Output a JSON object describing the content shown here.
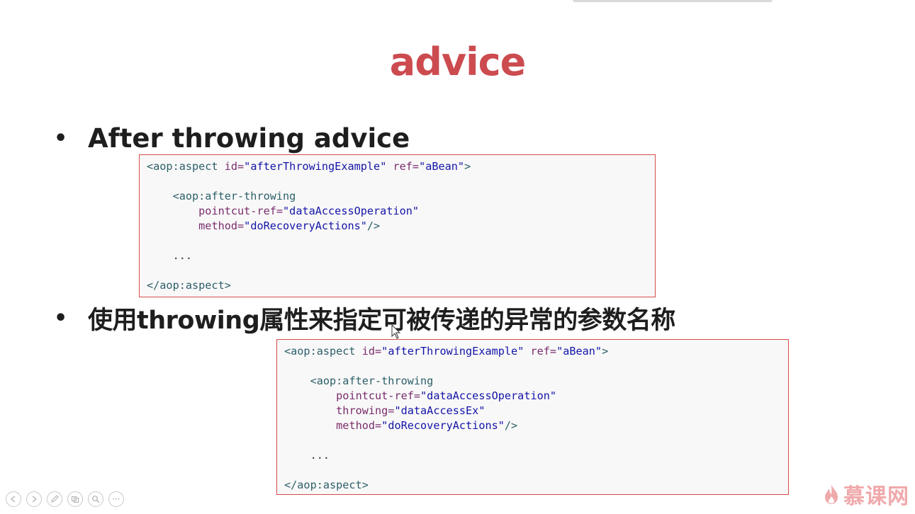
{
  "slide": {
    "title": "advice",
    "bullets": [
      {
        "text": "After throwing advice"
      },
      {
        "text": "使用throwing属性来指定可被传递的异常的参数名称"
      }
    ],
    "bullet_symbol": "•"
  },
  "code_block_1": {
    "l1": {
      "tag_open": "<aop:aspect ",
      "attr1": "id=",
      "val1": "\"afterThrowingExample\"",
      "attr2": " ref=",
      "val2": "\"aBean\"",
      "tag_close": ">"
    },
    "l2": {
      "tag": "<aop:after-throwing"
    },
    "l3": {
      "attr": "pointcut-ref=",
      "val": "\"dataAccessOperation\""
    },
    "l4": {
      "attr": "method=",
      "val": "\"doRecoveryActions\"",
      "tag_close": "/>"
    },
    "l5": {
      "text": "..."
    },
    "l6": {
      "tag": "</aop:aspect>"
    }
  },
  "code_block_2": {
    "l1": {
      "tag_open": "<aop:aspect ",
      "attr1": "id=",
      "val1": "\"afterThrowingExample\"",
      "attr2": " ref=",
      "val2": "\"aBean\"",
      "tag_close": ">"
    },
    "l2": {
      "tag": "<aop:after-throwing"
    },
    "l3": {
      "attr": "pointcut-ref=",
      "val": "\"dataAccessOperation\""
    },
    "l4": {
      "attr": "throwing=",
      "val": "\"dataAccessEx\""
    },
    "l5": {
      "attr": "method=",
      "val": "\"doRecoveryActions\"",
      "tag_close": "/>"
    },
    "l6": {
      "text": "..."
    },
    "l7": {
      "tag": "</aop:aspect>"
    }
  },
  "controls": {
    "icons": [
      "previous-icon",
      "next-icon",
      "pen-icon",
      "slides-icon",
      "zoom-icon",
      "more-icon"
    ],
    "more_label": "•••"
  },
  "brand": {
    "name": "慕课网",
    "icon": "flame-icon"
  },
  "colors": {
    "title": "#cc4b4f",
    "code_border": "#d94a4a",
    "brand": "#f0a9ab"
  }
}
